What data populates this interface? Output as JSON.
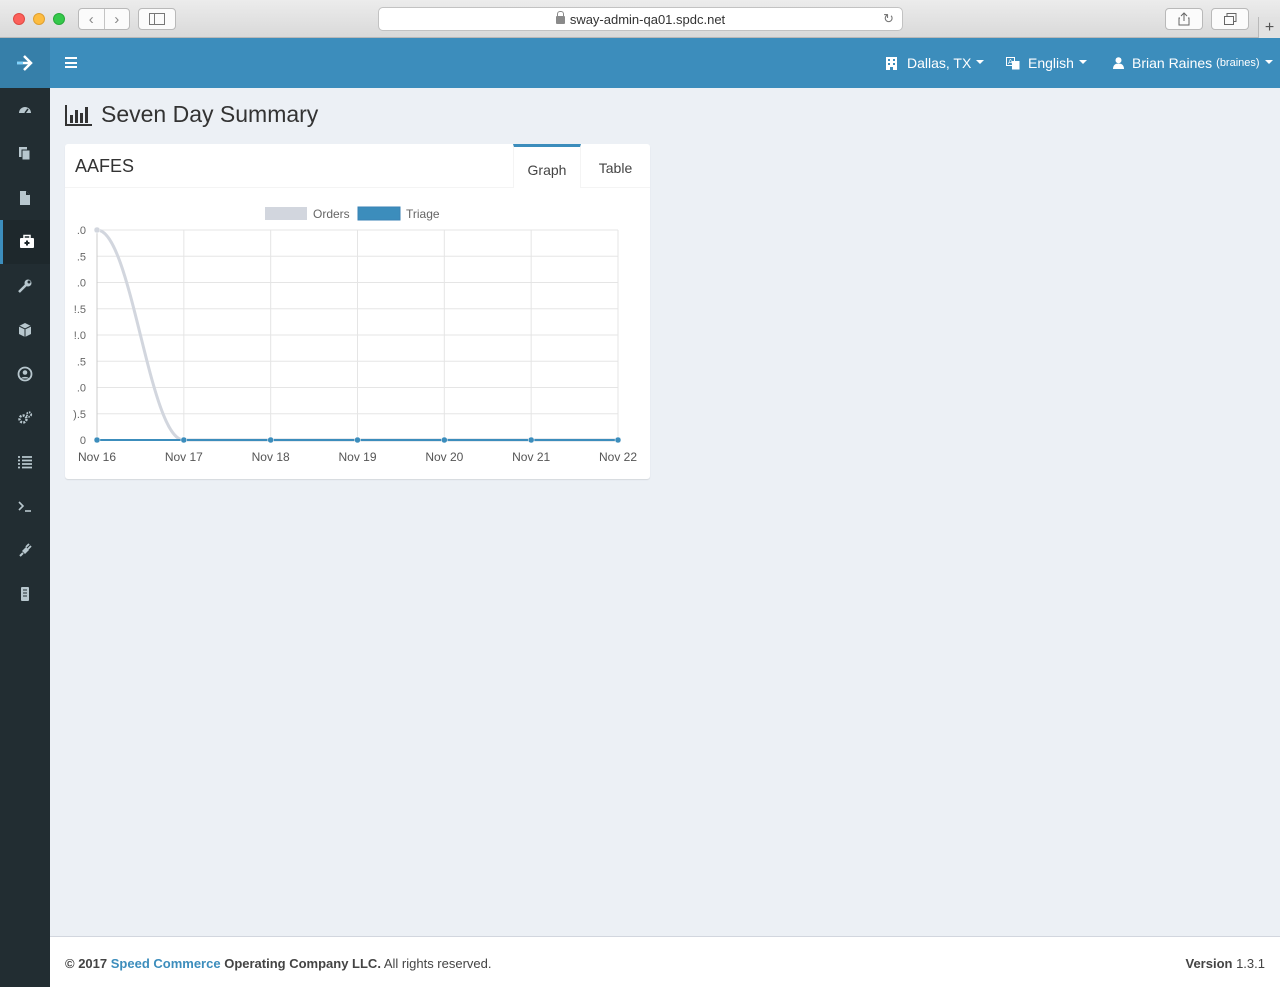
{
  "browser": {
    "url": "sway-admin-qa01.spdc.net"
  },
  "sidebar": {
    "items": [
      {
        "icon": "dashboard-icon"
      },
      {
        "icon": "files-icon"
      },
      {
        "icon": "file-icon"
      },
      {
        "icon": "medkit-icon",
        "active": true
      },
      {
        "icon": "wrench-icon"
      },
      {
        "icon": "cube-icon"
      },
      {
        "icon": "user-circle-icon"
      },
      {
        "icon": "cogs-icon"
      },
      {
        "icon": "list-icon"
      },
      {
        "icon": "terminal-icon"
      },
      {
        "icon": "plug-icon"
      },
      {
        "icon": "server-icon"
      }
    ]
  },
  "header": {
    "location": "Dallas, TX",
    "language": "English",
    "user_name": "Brian Raines",
    "user_handle": "(braines)"
  },
  "page": {
    "title": "Seven Day Summary"
  },
  "box": {
    "title": "AAFES",
    "tabs": [
      "Graph",
      "Table"
    ],
    "active_tab": "Graph"
  },
  "chart_data": {
    "type": "line",
    "categories": [
      "Nov 16",
      "Nov 17",
      "Nov 18",
      "Nov 19",
      "Nov 20",
      "Nov 21",
      "Nov 22"
    ],
    "series": [
      {
        "name": "Orders",
        "values": [
          4,
          0,
          0,
          0,
          0,
          0,
          0
        ],
        "color": "#d2d6de"
      },
      {
        "name": "Triage",
        "values": [
          0,
          0,
          0,
          0,
          0,
          0,
          0
        ],
        "color": "#3c8dbc"
      }
    ],
    "y_ticks": [
      {
        "v": 0,
        "label": "0"
      },
      {
        "v": 0.5,
        "label": ").5"
      },
      {
        "v": 1,
        "label": ".0"
      },
      {
        "v": 1.5,
        "label": ".5"
      },
      {
        "v": 2,
        "label": "!.0"
      },
      {
        "v": 2.5,
        "label": "!.5"
      },
      {
        "v": 3,
        "label": ".0"
      },
      {
        "v": 3.5,
        "label": ".5"
      },
      {
        "v": 4,
        "label": ".0"
      }
    ],
    "ylim": [
      0,
      4
    ],
    "grid": true,
    "legend": "top-center"
  },
  "footer": {
    "copyright": "© 2017",
    "company_link": "Speed Commerce",
    "company_rest": "Operating Company LLC.",
    "rights": "All rights reserved.",
    "version_label": "Version",
    "version_value": "1.3.1"
  }
}
